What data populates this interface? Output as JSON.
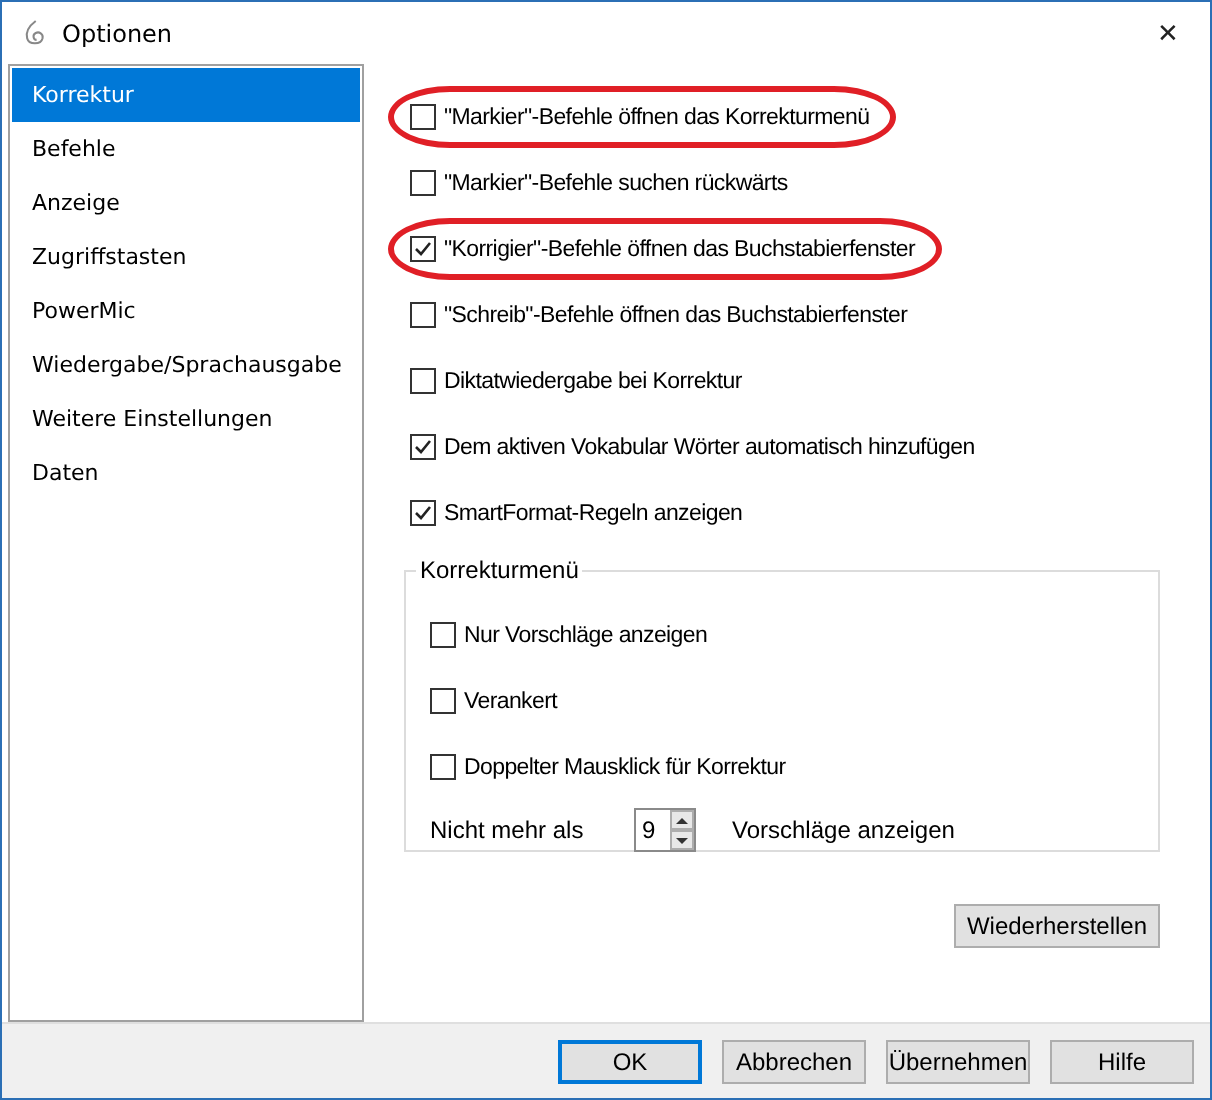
{
  "window": {
    "title": "Optionen",
    "close": "✕"
  },
  "sidebar": {
    "items": [
      {
        "label": "Korrektur",
        "selected": true
      },
      {
        "label": "Befehle",
        "selected": false
      },
      {
        "label": "Anzeige",
        "selected": false
      },
      {
        "label": "Zugriffstasten",
        "selected": false
      },
      {
        "label": "PowerMic",
        "selected": false
      },
      {
        "label": "Wiedergabe/Sprachausgabe",
        "selected": false
      },
      {
        "label": "Weitere Einstellungen",
        "selected": false
      },
      {
        "label": "Daten",
        "selected": false
      }
    ]
  },
  "options": [
    {
      "label": "\"Markier\"-Befehle öffnen das Korrekturmenü",
      "checked": false,
      "highlighted": true
    },
    {
      "label": "\"Markier\"-Befehle suchen rückwärts",
      "checked": false,
      "highlighted": false
    },
    {
      "label": "\"Korrigier\"-Befehle öffnen das Buchstabierfenster",
      "checked": true,
      "highlighted": true
    },
    {
      "label": "\"Schreib\"-Befehle öffnen das Buchstabierfenster",
      "checked": false,
      "highlighted": false
    },
    {
      "label": "Diktatwiedergabe bei Korrektur",
      "checked": false,
      "highlighted": false
    },
    {
      "label": "Dem aktiven Vokabular Wörter automatisch hinzufügen",
      "checked": true,
      "highlighted": false
    },
    {
      "label": "SmartFormat-Regeln anzeigen",
      "checked": true,
      "highlighted": false
    }
  ],
  "group": {
    "title": "Korrekturmenü",
    "options": [
      {
        "label": "Nur Vorschläge anzeigen",
        "checked": false
      },
      {
        "label": "Verankert",
        "checked": false
      },
      {
        "label": "Doppelter Mausklick für Korrektur",
        "checked": false
      }
    ],
    "limit": {
      "prefix": "Nicht mehr als",
      "value": "9",
      "suffix": "Vorschläge anzeigen"
    }
  },
  "restore_button": "Wiederherstellen",
  "buttons": [
    {
      "label": "OK",
      "default": true
    },
    {
      "label": "Abbrechen",
      "default": false
    },
    {
      "label": "Übernehmen",
      "default": false
    },
    {
      "label": "Hilfe",
      "default": false
    }
  ]
}
